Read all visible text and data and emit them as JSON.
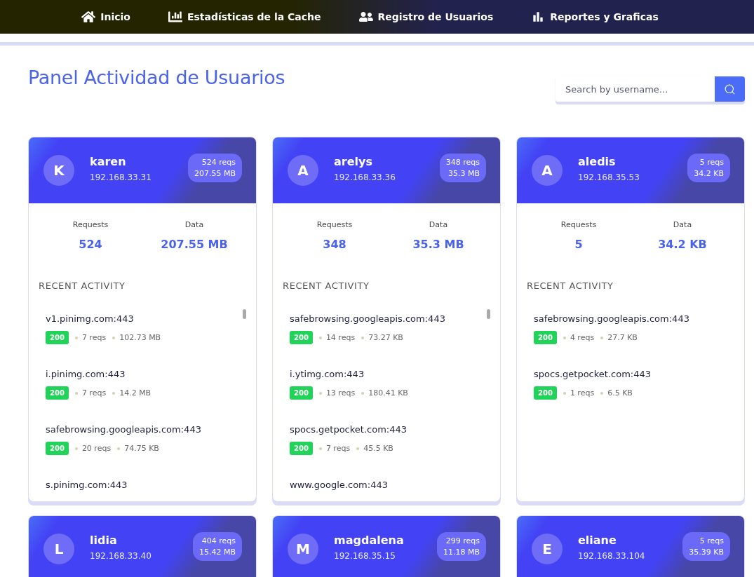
{
  "nav": [
    {
      "kind": "home",
      "label": "Inicio"
    },
    {
      "kind": "stats",
      "label": "Estadísticas de la Cache"
    },
    {
      "kind": "users",
      "label": "Registro de Usuarios"
    },
    {
      "kind": "reports",
      "label": "Reportes y Graficas"
    }
  ],
  "title": "Panel Actividad de Usuarios",
  "search": {
    "placeholder": "Search by username..."
  },
  "users": [
    {
      "initial": "K",
      "name": "karen",
      "ip": "192.168.33.31",
      "badge_reqs": "524 reqs",
      "badge_data": "207.55 MB",
      "stats": [
        {
          "label": "Requests",
          "value": "524"
        },
        {
          "label": "Data",
          "value": "207.55 MB"
        }
      ],
      "activity_title": "RECENT ACTIVITY",
      "scrollable": true,
      "activity": [
        {
          "host": "v1.pinimg.com:443",
          "status": "200",
          "reqs": "7 reqs",
          "size": "102.73 MB"
        },
        {
          "host": "i.pinimg.com:443",
          "status": "200",
          "reqs": "7 reqs",
          "size": "14.2 MB"
        },
        {
          "host": "safebrowsing.googleapis.com:443",
          "status": "200",
          "reqs": "20 reqs",
          "size": "74.75 KB"
        },
        {
          "host": "s.pinimg.com:443"
        }
      ]
    },
    {
      "initial": "A",
      "name": "arelys",
      "ip": "192.168.33.36",
      "badge_reqs": "348 reqs",
      "badge_data": "35.3 MB",
      "stats": [
        {
          "label": "Requests",
          "value": "348"
        },
        {
          "label": "Data",
          "value": "35.3 MB"
        }
      ],
      "activity_title": "RECENT ACTIVITY",
      "scrollable": true,
      "activity": [
        {
          "host": "safebrowsing.googleapis.com:443",
          "status": "200",
          "reqs": "14 reqs",
          "size": "73.27 KB"
        },
        {
          "host": "i.ytimg.com:443",
          "status": "200",
          "reqs": "13 reqs",
          "size": "180.41 KB"
        },
        {
          "host": "spocs.getpocket.com:443",
          "status": "200",
          "reqs": "7 reqs",
          "size": "45.5 KB"
        },
        {
          "host": "www.google.com:443"
        }
      ]
    },
    {
      "initial": "A",
      "name": "aledis",
      "ip": "192.168.35.53",
      "badge_reqs": "5 reqs",
      "badge_data": "34.2 KB",
      "stats": [
        {
          "label": "Requests",
          "value": "5"
        },
        {
          "label": "Data",
          "value": "34.2 KB"
        }
      ],
      "activity_title": "RECENT ACTIVITY",
      "scrollable": false,
      "activity": [
        {
          "host": "safebrowsing.googleapis.com:443",
          "status": "200",
          "reqs": "4 reqs",
          "size": "27.7 KB"
        },
        {
          "host": "spocs.getpocket.com:443",
          "status": "200",
          "reqs": "1 reqs",
          "size": "6.5 KB"
        }
      ]
    },
    {
      "initial": "L",
      "name": "lidia",
      "ip": "192.168.33.40",
      "badge_reqs": "404 reqs",
      "badge_data": "15.42 MB"
    },
    {
      "initial": "M",
      "name": "magdalena",
      "ip": "192.168.35.15",
      "badge_reqs": "299 reqs",
      "badge_data": "11.18 MB"
    },
    {
      "initial": "E",
      "name": "eliane",
      "ip": "192.168.33.104",
      "badge_reqs": "5 reqs",
      "badge_data": "35.39 KB"
    }
  ]
}
